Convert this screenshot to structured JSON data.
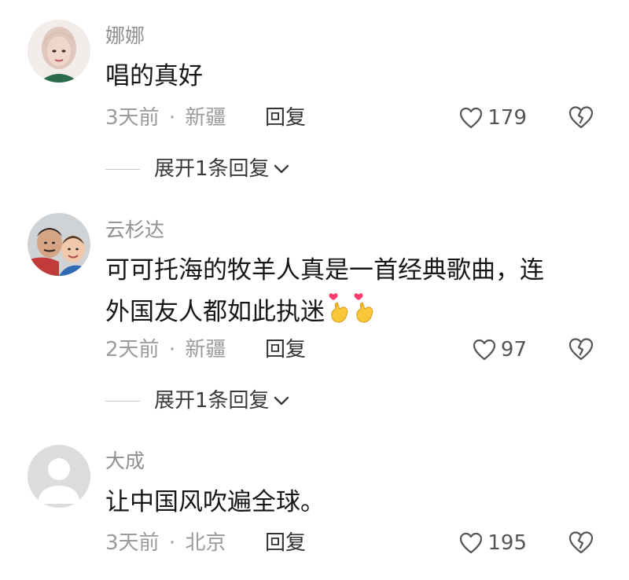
{
  "comments": [
    {
      "username": "娜娜",
      "text_lines": [
        "唱的真好"
      ],
      "time": "3天前",
      "dot": "·",
      "location": "新疆",
      "reply_label": "回复",
      "likes": "179",
      "expand_label": "展开1条回复",
      "like_icon": "heart-outline-icon",
      "dislike_icon": "broken-heart-icon"
    },
    {
      "username": "云杉达",
      "text_lines": [
        "可可托海的牧羊人真是一首经典歌曲，连",
        "外国友人都如此执迷"
      ],
      "emoji": "finger-heart-emoji",
      "time": "2天前",
      "dot": "·",
      "location": "新疆",
      "reply_label": "回复",
      "likes": "97",
      "expand_label": "展开1条回复",
      "like_icon": "heart-outline-icon",
      "dislike_icon": "broken-heart-icon"
    },
    {
      "username": "大成",
      "text_lines": [
        "让中国风吹遍全球。"
      ],
      "time": "3天前",
      "dot": "·",
      "location": "北京",
      "reply_label": "回复",
      "likes": "195",
      "like_icon": "heart-outline-icon",
      "dislike_icon": "broken-heart-icon"
    }
  ],
  "colors": {
    "username": "#8f8f94",
    "text": "#161616",
    "meta": "#9a9a9f",
    "reply": "#333333",
    "emoji_heart": "#ff3b6b",
    "emoji_hand": "#f9c63a"
  }
}
